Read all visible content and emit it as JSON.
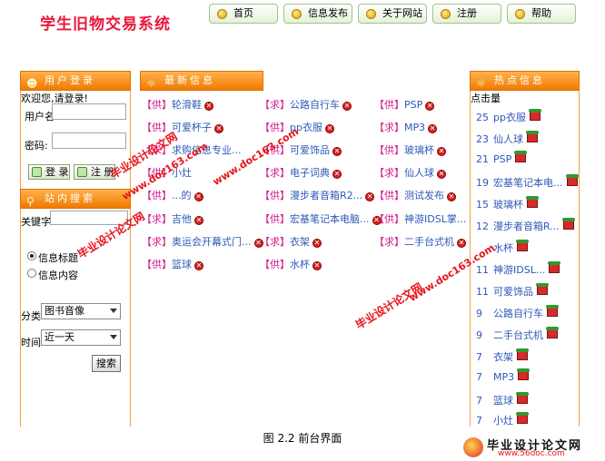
{
  "site": {
    "title": "学生旧物交易系统"
  },
  "nav": [
    "首页",
    "信息发布",
    "关于网站",
    "注册",
    "帮助"
  ],
  "login": {
    "header": "用户登录",
    "welcome": "欢迎您,请登录!",
    "username_label": "用户名:",
    "password_label": "密码:",
    "login_button": "登 录",
    "register_button": "注 册"
  },
  "search": {
    "header": "站内搜索",
    "keyword_label": "关键字",
    "option_title": "信息标题",
    "option_content": "信息内容",
    "category_label": "分类",
    "category_value": "图书音像",
    "time_label": "时间",
    "time_value": "近一天",
    "search_button": "搜索"
  },
  "latest": {
    "header": "最新信息",
    "items": [
      {
        "tag": "【供】",
        "title": "轮滑鞋"
      },
      {
        "tag": "【求】",
        "title": "公路自行车"
      },
      {
        "tag": "【供】",
        "title": "PSP"
      },
      {
        "tag": "【供】",
        "title": "可爱杯子"
      },
      {
        "tag": "【供】",
        "title": "pp衣服"
      },
      {
        "tag": "【求】",
        "title": "MP3"
      },
      {
        "tag": "【求】",
        "title": "求购信息专业..."
      },
      {
        "tag": "【供】",
        "title": "可爱饰品"
      },
      {
        "tag": "【供】",
        "title": "玻璃杯"
      },
      {
        "tag": "【供】",
        "title": "小灶"
      },
      {
        "tag": "【求】",
        "title": "电子词典"
      },
      {
        "tag": "【求】",
        "title": "仙人球"
      },
      {
        "tag": "【供】",
        "title": "...的"
      },
      {
        "tag": "【供】",
        "title": "漫步者音箱R2..."
      },
      {
        "tag": "【供】",
        "title": "测试发布"
      },
      {
        "tag": "【求】",
        "title": "吉他"
      },
      {
        "tag": "【供】",
        "title": "宏基笔记本电脑..."
      },
      {
        "tag": "【供】",
        "title": "神游IDSL掌..."
      },
      {
        "tag": "【求】",
        "title": "奥运会开幕式门..."
      },
      {
        "tag": "【求】",
        "title": "衣架"
      },
      {
        "tag": "【求】",
        "title": "二手台式机"
      },
      {
        "tag": "【供】",
        "title": "篮球"
      },
      {
        "tag": "【供】",
        "title": "水杯"
      }
    ]
  },
  "hot": {
    "header": "热点信息",
    "sub_header": "点击量",
    "items": [
      {
        "count": "25",
        "name": "pp衣服"
      },
      {
        "count": "23",
        "name": "仙人球"
      },
      {
        "count": "21",
        "name": "PSP"
      },
      {
        "count": "19",
        "name": "宏基笔记本电..."
      },
      {
        "count": "15",
        "name": "玻璃杯"
      },
      {
        "count": "12",
        "name": "漫步者音箱R..."
      },
      {
        "count": "",
        "name": "水杯"
      },
      {
        "count": "11",
        "name": "神游IDSL..."
      },
      {
        "count": "11",
        "name": "可爱饰品"
      },
      {
        "count": "9",
        "name": "公路自行车"
      },
      {
        "count": "9",
        "name": "二手台式机"
      },
      {
        "count": "7",
        "name": "衣架"
      },
      {
        "count": "7",
        "name": "MP3"
      },
      {
        "count": "7",
        "name": "篮球"
      },
      {
        "count": "7",
        "name": "小灶"
      }
    ]
  },
  "caption": "图 2.2 前台界面",
  "watermarks": {
    "w1": "毕业设计论文网",
    "w2": "www.doc163.com",
    "w3": "毕业设计论文网",
    "w4": "www.doc163.com",
    "w5": "毕业设计论文网",
    "w6": "www.doc163.com",
    "corner_name": "毕业设计论文网",
    "corner_url": "www.56doc.com"
  },
  "colors": {
    "accent": "#f07a00",
    "link": "#2d59b8",
    "tag": "#d11a8a",
    "watermark": "#e8141a"
  }
}
